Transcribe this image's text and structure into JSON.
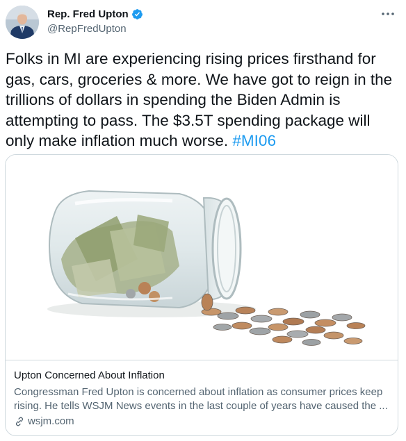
{
  "tweet": {
    "author": {
      "display_name": "Rep. Fred Upton",
      "handle": "@RepFredUpton",
      "verified": true,
      "avatar_icon": "profile-photo"
    },
    "more_icon": "ellipsis-icon",
    "text_main": "Folks in MI are experiencing rising prices firsthand for gas, cars, groceries & more. We have got to reign in the trillions of dollars in spending the Biden Admin is attempting to pass. The $3.5T spending package will only make inflation much worse.",
    "hashtag": "#MI06",
    "card": {
      "image_icon": "money-jar-image",
      "title": "Upton Concerned About Inflation",
      "description": "Congressman Fred Upton is concerned about inflation as consumer prices keep rising. He tells WSJM News events in the last couple of years have caused the ...",
      "domain": "wsjm.com",
      "domain_icon": "link-icon"
    },
    "colors": {
      "accent": "#1d9bf0",
      "text": "#0f1419",
      "secondary": "#536471",
      "border": "#cfd9de"
    }
  }
}
